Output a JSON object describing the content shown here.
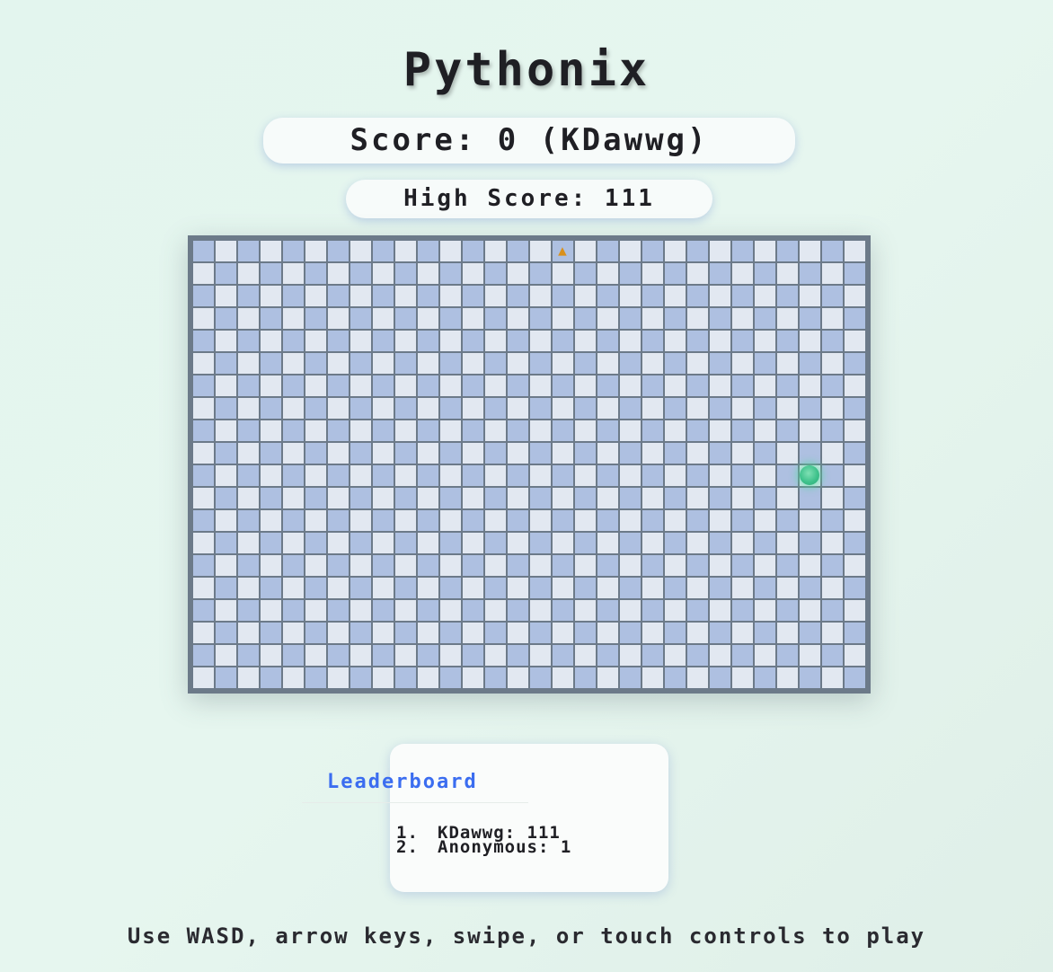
{
  "header": {
    "title": "Pythonix"
  },
  "score": {
    "label": "Score: 0 (KDawwg)"
  },
  "high_score": {
    "label": "High Score: 111"
  },
  "board": {
    "columns": 30,
    "rows": 20,
    "colors": {
      "dark_cell": "#aec0e1",
      "light_cell": "#e2e8f1",
      "border": "#6c7a89",
      "snake": "#3fc28c",
      "food": "#d9901c"
    },
    "food_icon": "cheese-icon",
    "snake_head": {
      "col": 27,
      "row": 10
    },
    "food": {
      "col": 16,
      "row": 0
    }
  },
  "leaderboard": {
    "title": "Leaderboard",
    "entries": [
      {
        "rank": "1.",
        "text": "KDawwg: 111"
      },
      {
        "rank": "2.",
        "text": "Anonymous: 1"
      }
    ]
  },
  "footer": {
    "instructions": "Use WASD, arrow keys, swipe, or touch controls to play"
  }
}
